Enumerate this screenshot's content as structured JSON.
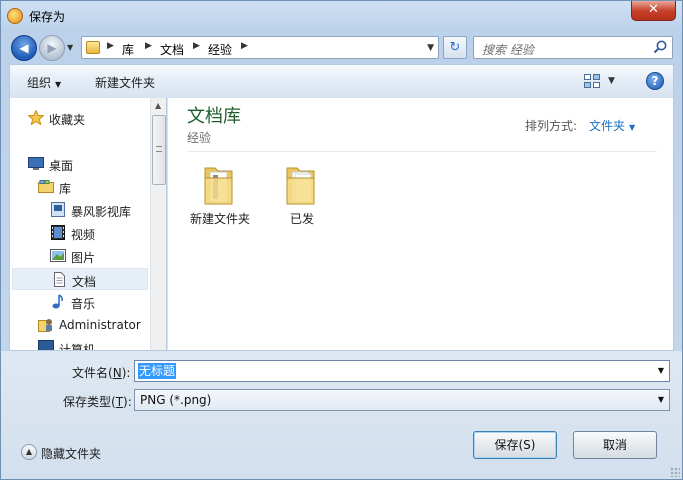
{
  "window": {
    "title": "保存为",
    "close_glyph": "✕"
  },
  "nav": {
    "back_glyph": "◀",
    "forward_glyph": "▶",
    "history_dropdown_glyph": "▼"
  },
  "address": {
    "breadcrumbs": [
      "库",
      "文档",
      "经验"
    ],
    "separator": "▶",
    "dropdown_glyph": "▼",
    "refresh_glyph": "↻"
  },
  "search": {
    "placeholder": "搜索 经验"
  },
  "toolbar": {
    "organize_label": "组织",
    "organize_arrow": "▼",
    "new_folder_label": "新建文件夹",
    "view_dropdown_glyph": "▼",
    "help_glyph": "?"
  },
  "navpane": {
    "favorites": {
      "label": "收藏夹",
      "icon": "star-icon"
    },
    "desktop": {
      "label": "桌面",
      "icon": "desktop-icon"
    },
    "libraries": {
      "label": "库",
      "icon": "library-icon"
    },
    "items": [
      {
        "label": "暴风影视库",
        "icon": "video-library-icon"
      },
      {
        "label": "视频",
        "icon": "video-icon"
      },
      {
        "label": "图片",
        "icon": "picture-icon"
      },
      {
        "label": "文档",
        "icon": "document-icon",
        "selected": true
      },
      {
        "label": "音乐",
        "icon": "music-icon"
      }
    ],
    "administrator": {
      "label": "Administrator",
      "icon": "user-folder-icon"
    },
    "computer": {
      "label": "计算机",
      "icon": "computer-icon"
    },
    "scroll_up_glyph": "▲"
  },
  "content": {
    "library_title": "文档库",
    "library_subtitle": "经验",
    "arrange_label": "排列方式:",
    "arrange_value": "文件夹",
    "arrange_arrow": "▼",
    "files": [
      {
        "name": "新建文件夹",
        "icon": "folder-icon"
      },
      {
        "name": "已发",
        "icon": "folder-icon"
      }
    ]
  },
  "bottom": {
    "filename_label": "文件名",
    "filename_hotkey": "N",
    "filename_suffix": "):",
    "filename_value": "无标题",
    "filetype_label": "保存类型",
    "filetype_hotkey": "T",
    "filetype_suffix": "):",
    "filetype_value": "PNG (*.png)",
    "dropdown_glyph": "▼",
    "hide_folders_label": "隐藏文件夹",
    "hide_folders_glyph": "▲",
    "save_label": "保存(S)",
    "cancel_label": "取消"
  },
  "colors": {
    "accent": "#1c6fc6",
    "library_title": "#1e5e2b",
    "selection": "#3399ff"
  }
}
